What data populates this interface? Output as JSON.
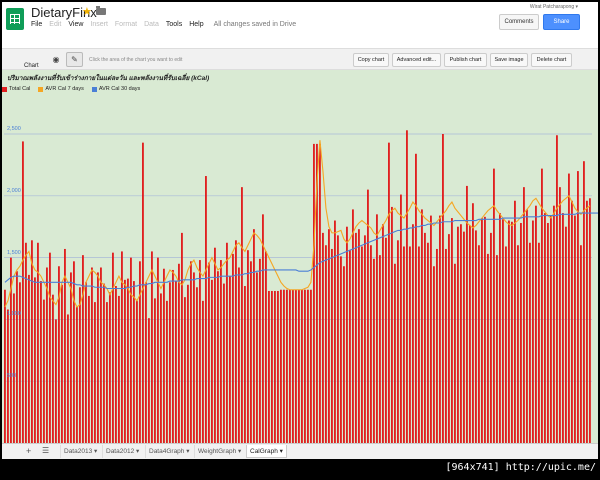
{
  "header": {
    "doc_title": "DietaryFinx",
    "user": "Wirat Patcharapong ▾",
    "menu": [
      {
        "label": "File",
        "dim": false
      },
      {
        "label": "Edit",
        "dim": true
      },
      {
        "label": "View",
        "dim": false
      },
      {
        "label": "Insert",
        "dim": true
      },
      {
        "label": "Format",
        "dim": true
      },
      {
        "label": "Data",
        "dim": true
      },
      {
        "label": "Tools",
        "dim": false
      },
      {
        "label": "Help",
        "dim": false
      }
    ],
    "saved_status": "All changes saved in Drive",
    "comments_label": "Comments",
    "share_label": "Share"
  },
  "chart_toolbar": {
    "label": "Chart",
    "hint": "Click the area of the chart you want to edit",
    "buttons": [
      "Copy chart",
      "Advanced edit...",
      "Publish chart",
      "Save image",
      "Delete chart"
    ]
  },
  "colors": {
    "total": "#e02020",
    "avr7": "#f5a623",
    "avr30": "#4a7fd6",
    "bg": "#d9ead3"
  },
  "tabs": {
    "sheets": [
      "Data2013",
      "Data2012",
      "Data4Graph",
      "WeightGraph",
      "CalGraph"
    ],
    "active": "CalGraph"
  },
  "watermark": "[964x741] http://upic.me/",
  "chart_data": {
    "type": "bar",
    "title": "ปริมาณพลังงานที่รับเข้าร่างกายในแต่ละวัน และพลังงานที่รับเฉลี่ย (kCal)",
    "ylim": [
      0,
      2500
    ],
    "yticks": [
      "2,500",
      "2,000",
      "1,500",
      "1,000",
      "500"
    ],
    "grid": true,
    "legend": "top-left",
    "series": [
      {
        "name": "Total Cal",
        "values": [
          1240,
          1080,
          1500,
          1210,
          1390,
          1300,
          2440,
          1620,
          1360,
          1640,
          1340,
          1620,
          1310,
          1160,
          1420,
          1540,
          1200,
          1000,
          1430,
          1280,
          1570,
          1040,
          1380,
          1470,
          1100,
          1260,
          1520,
          1300,
          1190,
          1420,
          1140,
          1380,
          1420,
          1290,
          1140,
          1220,
          1540,
          1270,
          1190,
          1550,
          1320,
          1330,
          1500,
          1310,
          1150,
          1470,
          2430,
          1300,
          1010,
          1550,
          1170,
          1500,
          1210,
          1410,
          1150,
          1300,
          1400,
          1310,
          1450,
          1700,
          1180,
          1280,
          1470,
          1380,
          1260,
          1480,
          1150,
          2160,
          1460,
          1320,
          1580,
          1390,
          1480,
          1290,
          1620,
          1350,
          1530,
          1640,
          1420,
          2070,
          1270,
          1560,
          1470,
          1730,
          1380,
          1490,
          1850,
          1550,
          1230,
          1230,
          1230,
          1230,
          1240,
          1240,
          1240,
          1240,
          1240,
          1240,
          1240,
          1240,
          1240,
          1240,
          1240,
          2420,
          2420,
          2420,
          1700,
          1600,
          1730,
          1570,
          1800,
          1680,
          1510,
          1430,
          1750,
          1560,
          1890,
          1700,
          1730,
          1590,
          1680,
          2050,
          1600,
          1490,
          1850,
          1520,
          1770,
          1660,
          2430,
          1910,
          1450,
          1640,
          2010,
          1590,
          2530,
          1590,
          1770,
          2340,
          1590,
          1890,
          1700,
          1620,
          1840,
          1430,
          1570,
          1840,
          2500,
          1570,
          1690,
          1820,
          1450,
          1750,
          1770,
          1710,
          2080,
          1760,
          1940,
          1720,
          1600,
          1820,
          1830,
          1530,
          1700,
          2220,
          1520,
          1860,
          1810,
          1590,
          1800,
          1790,
          1960,
          1600,
          1780,
          2070,
          1890,
          1620,
          1800,
          1920,
          1620,
          2220,
          1860,
          1780,
          1840,
          1920,
          2490,
          2070,
          1860,
          1750,
          2180,
          1960,
          1840,
          2200,
          1600,
          2280,
          1960,
          1980
        ]
      },
      {
        "name": "AVR Cal 7 days",
        "values": [
          1100,
          1150,
          1250,
          1350,
          1400,
          1430,
          1480,
          1520,
          1550,
          1450,
          1400,
          1380,
          1350,
          1300,
          1250,
          1180,
          1150,
          1120,
          1180,
          1300,
          1350,
          1300,
          1250,
          1150,
          1100,
          1120,
          1200,
          1300,
          1350,
          1400,
          1380,
          1350,
          1300,
          1280,
          1250,
          1200,
          1250,
          1300,
          1350,
          1300,
          1280,
          1250,
          1200,
          1180,
          1150,
          1200,
          1250,
          1300,
          1350,
          1400,
          1350,
          1300,
          1250,
          1300,
          1350,
          1400,
          1380,
          1350,
          1300,
          1280,
          1320,
          1400,
          1450,
          1480,
          1420,
          1380,
          1350,
          1400,
          1450,
          1500,
          1450,
          1400,
          1420,
          1450,
          1480,
          1500,
          1550,
          1600,
          1620,
          1580,
          1550,
          1600,
          1650,
          1700,
          1680,
          1650,
          1600,
          1550,
          1500,
          1450,
          1400,
          1350,
          1300,
          1270,
          1250,
          1240,
          1240,
          1240,
          1240,
          1240,
          1250,
          1260,
          1300,
          1600,
          2100,
          2450,
          2200,
          1900,
          1750,
          1700,
          1700,
          1710,
          1720,
          1650,
          1620,
          1650,
          1700,
          1750,
          1780,
          1800,
          1780,
          1760,
          1740,
          1700,
          1680,
          1720,
          1760,
          1800,
          1850,
          1880,
          1900,
          1860,
          1840,
          1820,
          1860,
          1900,
          1950,
          1920,
          1880,
          1850,
          1820,
          1800,
          1780,
          1760,
          1790,
          1820,
          1850,
          1880,
          1920,
          1950,
          1900,
          1870,
          1840,
          1810,
          1780,
          1760,
          1740,
          1760,
          1790,
          1820,
          1850,
          1880,
          1900,
          1920,
          1880,
          1850,
          1820,
          1790,
          1770,
          1760,
          1780,
          1800,
          1830,
          1860,
          1890,
          1920,
          1960,
          1980,
          1940,
          1900,
          1870,
          1840,
          1820,
          1860,
          1900,
          1930,
          1960,
          1980,
          2000,
          1950,
          1900,
          1870,
          1850,
          1880,
          1900,
          1920
        ]
      },
      {
        "name": "AVR Cal 30 days",
        "values": [
          1300,
          1320,
          1340,
          1350,
          1350,
          1350,
          1340,
          1330,
          1320,
          1310,
          1300,
          1300,
          1300,
          1300,
          1300,
          1300,
          1300,
          1300,
          1300,
          1300,
          1300,
          1300,
          1300,
          1290,
          1280,
          1280,
          1270,
          1270,
          1270,
          1270,
          1260,
          1260,
          1260,
          1260,
          1250,
          1250,
          1250,
          1250,
          1250,
          1250,
          1250,
          1260,
          1260,
          1270,
          1270,
          1280,
          1280,
          1280,
          1290,
          1290,
          1300,
          1300,
          1300,
          1300,
          1300,
          1310,
          1310,
          1310,
          1310,
          1320,
          1320,
          1320,
          1320,
          1320,
          1330,
          1330,
          1330,
          1330,
          1340,
          1340,
          1340,
          1340,
          1350,
          1350,
          1350,
          1350,
          1350,
          1360,
          1360,
          1360,
          1370,
          1370,
          1380,
          1380,
          1390,
          1390,
          1400,
          1400,
          1400,
          1400,
          1400,
          1400,
          1400,
          1400,
          1400,
          1400,
          1400,
          1400,
          1390,
          1390,
          1390,
          1390,
          1400,
          1420,
          1440,
          1460,
          1470,
          1480,
          1490,
          1500,
          1510,
          1520,
          1530,
          1540,
          1550,
          1560,
          1570,
          1580,
          1590,
          1600,
          1610,
          1620,
          1630,
          1640,
          1650,
          1660,
          1670,
          1680,
          1690,
          1700,
          1710,
          1720,
          1720,
          1730,
          1730,
          1740,
          1740,
          1750,
          1750,
          1760,
          1760,
          1770,
          1770,
          1780,
          1780,
          1780,
          1790,
          1790,
          1790,
          1790,
          1800,
          1800,
          1800,
          1800,
          1800,
          1800,
          1800,
          1800,
          1810,
          1810,
          1810,
          1810,
          1810,
          1810,
          1810,
          1810,
          1820,
          1820,
          1820,
          1820,
          1820,
          1820,
          1820,
          1830,
          1830,
          1830,
          1830,
          1830,
          1830,
          1840,
          1840,
          1840,
          1840,
          1840,
          1840,
          1850,
          1850,
          1850,
          1850,
          1850,
          1850,
          1860,
          1860,
          1860,
          1860,
          1860,
          1860,
          1860,
          1860,
          1860,
          1870,
          1870,
          1870,
          1870,
          1870,
          1870
        ]
      }
    ]
  }
}
